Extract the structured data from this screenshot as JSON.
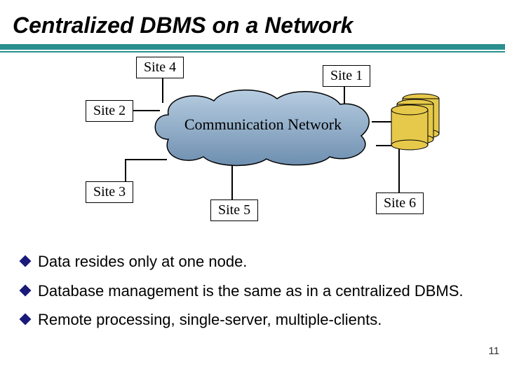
{
  "title": "Centralized DBMS on a Network",
  "diagram": {
    "cloud_label": "Communication Network",
    "sites": {
      "s1": "Site 1",
      "s2": "Site 2",
      "s3": "Site 3",
      "s4": "Site 4",
      "s5": "Site 5",
      "s6": "Site 6"
    }
  },
  "bullets": [
    "Data resides only at one node.",
    "Database management is the same as in a centralized DBMS.",
    "Remote processing, single-server, multiple-clients."
  ],
  "page_number": "11",
  "colors": {
    "rule": "#2a8f8f",
    "cloud_fill_top": "#9fb8d3",
    "cloud_fill_bottom": "#6a8aad",
    "db_fill": "#e6c94a",
    "bullet_diamond": "#1a1a7a"
  }
}
